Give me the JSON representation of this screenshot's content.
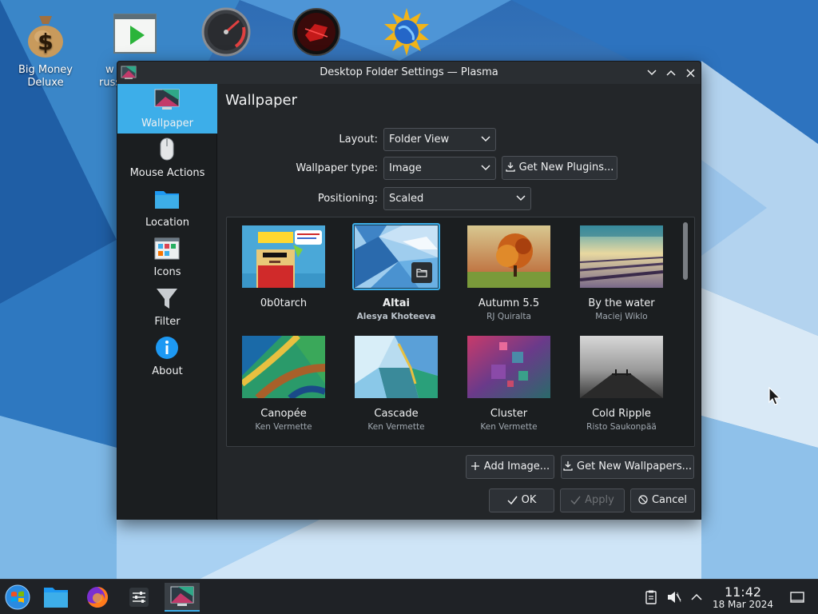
{
  "desktop": {
    "icons": [
      {
        "label_line1": "Big Money",
        "label_line2": "Deluxe",
        "icon": "money-bag-icon"
      },
      {
        "label_line1": "w",
        "label_line2": "russ",
        "icon": "video-player-icon"
      },
      {
        "label_line1": "",
        "label_line2": "",
        "icon": "speedometer-icon"
      },
      {
        "label_line1": "",
        "label_line2": "",
        "icon": "red-game-icon"
      },
      {
        "label_line1": "",
        "label_line2": "",
        "icon": "globe-sun-icon"
      }
    ]
  },
  "dialog": {
    "title": "Desktop Folder Settings — Plasma",
    "sidebar": [
      {
        "label": "Wallpaper",
        "icon": "wallpaper-icon",
        "active": true
      },
      {
        "label": "Mouse Actions",
        "icon": "mouse-icon",
        "active": false
      },
      {
        "label": "Location",
        "icon": "folder-icon",
        "active": false
      },
      {
        "label": "Icons",
        "icon": "icons-view-icon",
        "active": false
      },
      {
        "label": "Filter",
        "icon": "filter-icon",
        "active": false
      },
      {
        "label": "About",
        "icon": "info-icon",
        "active": false
      }
    ],
    "page_title": "Wallpaper",
    "form": {
      "layout_label": "Layout:",
      "layout_value": "Folder View",
      "wallpaper_type_label": "Wallpaper type:",
      "wallpaper_type_value": "Image",
      "get_plugins_label": "Get New Plugins...",
      "positioning_label": "Positioning:",
      "positioning_value": "Scaled"
    },
    "wallpapers": [
      {
        "name": "0b0tarch",
        "author": "",
        "selected": false
      },
      {
        "name": "Altai",
        "author": "Alesya Khoteeva",
        "selected": true
      },
      {
        "name": "Autumn 5.5",
        "author": "RJ Quiralta",
        "selected": false
      },
      {
        "name": "By the water",
        "author": "Maciej Wiklo",
        "selected": false
      },
      {
        "name": "Canopée",
        "author": "Ken Vermette",
        "selected": false
      },
      {
        "name": "Cascade",
        "author": "Ken Vermette",
        "selected": false
      },
      {
        "name": "Cluster",
        "author": "Ken Vermette",
        "selected": false
      },
      {
        "name": "Cold Ripple",
        "author": "Risto Saukonpää",
        "selected": false
      }
    ],
    "add_image_label": "Add Image...",
    "get_wallpapers_label": "Get New Wallpapers...",
    "ok_label": "OK",
    "apply_label": "Apply",
    "cancel_label": "Cancel"
  },
  "taskbar": {
    "time": "11:42",
    "date": "18 Mar 2024"
  },
  "colors": {
    "accent": "#3daee9",
    "window_bg": "#232629",
    "sidebar_bg": "#1b1e20",
    "panel_bg": "#1f2226"
  }
}
